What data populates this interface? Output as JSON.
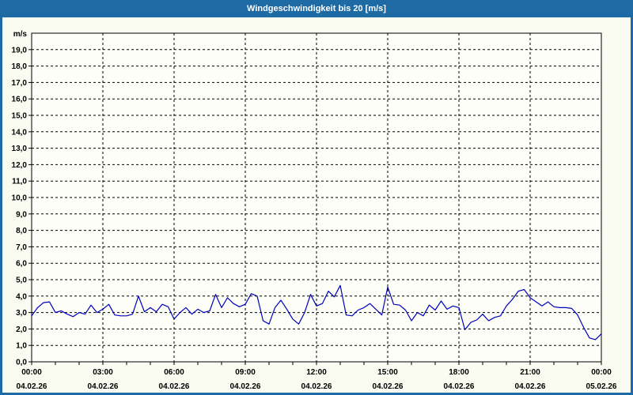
{
  "window": {
    "title": "Windgeschwindigkeit bis 20 [m/s]"
  },
  "colors": {
    "titlebar": "#1d6aa5",
    "frame_border": "#1d6aa5",
    "chart_background": "#fafcf2",
    "plot_background": "#fdfef8",
    "grid": "#000000",
    "axis": "#000000",
    "line": "#0000be",
    "title_text": "#ffffff",
    "label_text": "#000000"
  },
  "chart_data": {
    "type": "line",
    "title": "Windgeschwindigkeit bis 20 [m/s]",
    "ylabel": "m/s",
    "xlabel": "",
    "ylim": [
      0,
      20
    ],
    "y_tick_step": 1,
    "y_tick_labels": [
      "0,0",
      "1,0",
      "2,0",
      "3,0",
      "4,0",
      "5,0",
      "6,0",
      "7,0",
      "8,0",
      "9,0",
      "10,0",
      "11,0",
      "12,0",
      "13,0",
      "14,0",
      "15,0",
      "16,0",
      "17,0",
      "18,0",
      "19,0"
    ],
    "grid": "dashed",
    "legend_position": "none",
    "x_hours_total": 24,
    "x_minor_tick_hours": 1,
    "x_major_ticks": [
      {
        "hour": 0,
        "time": "00:00",
        "date": "04.02.26"
      },
      {
        "hour": 3,
        "time": "03:00",
        "date": "04.02.26"
      },
      {
        "hour": 6,
        "time": "06:00",
        "date": "04.02.26"
      },
      {
        "hour": 9,
        "time": "09:00",
        "date": "04.02.26"
      },
      {
        "hour": 12,
        "time": "12:00",
        "date": "04.02.26"
      },
      {
        "hour": 15,
        "time": "15:00",
        "date": "04.02.26"
      },
      {
        "hour": 18,
        "time": "18:00",
        "date": "04.02.26"
      },
      {
        "hour": 21,
        "time": "21:00",
        "date": "04.02.26"
      },
      {
        "hour": 24,
        "time": "00:00",
        "date": "05.02.26"
      }
    ],
    "series": [
      {
        "name": "Windgeschwindigkeit [m/s]",
        "start_time": "00:00",
        "interval_minutes": 15,
        "values": [
          2.8,
          3.3,
          3.6,
          3.65,
          3.0,
          3.1,
          2.9,
          2.75,
          3.0,
          2.9,
          3.45,
          3.0,
          3.2,
          3.5,
          2.85,
          2.8,
          2.8,
          2.9,
          4.0,
          3.05,
          3.3,
          3.05,
          3.5,
          3.35,
          2.6,
          3.0,
          3.3,
          2.9,
          3.2,
          3.0,
          3.1,
          4.1,
          3.3,
          3.9,
          3.55,
          3.35,
          3.5,
          4.15,
          4.0,
          2.5,
          2.3,
          3.3,
          3.75,
          3.2,
          2.6,
          2.3,
          3.0,
          4.1,
          3.4,
          3.55,
          4.3,
          3.95,
          4.65,
          2.85,
          2.8,
          3.15,
          3.3,
          3.55,
          3.2,
          2.85,
          4.55,
          3.5,
          3.45,
          3.15,
          2.5,
          3.0,
          2.8,
          3.45,
          3.15,
          3.7,
          3.2,
          3.4,
          3.3,
          1.95,
          2.4,
          2.55,
          2.9,
          2.5,
          2.7,
          2.8,
          3.4,
          3.8,
          4.3,
          4.4,
          3.9,
          3.65,
          3.4,
          3.65,
          3.35,
          3.3,
          3.3,
          3.25,
          2.85,
          2.1,
          1.45,
          1.35,
          1.7
        ]
      }
    ]
  }
}
